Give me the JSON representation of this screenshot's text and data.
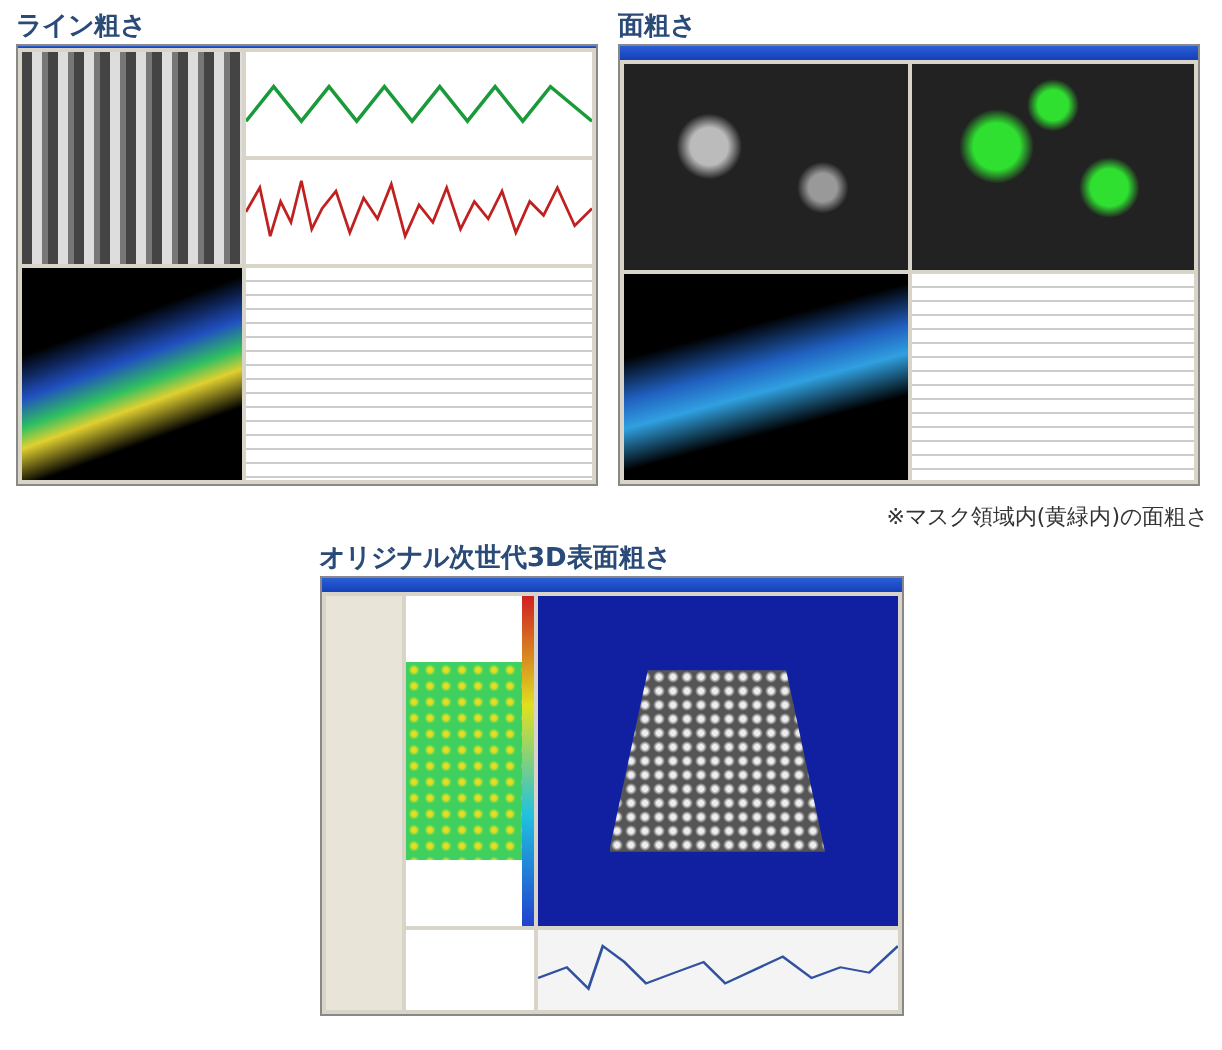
{
  "sections": [
    {
      "kind": "line",
      "title": "ライン粗さ"
    },
    {
      "kind": "area",
      "title": "面粗さ",
      "note": "※マスク領域内(黄緑内)の面粗さ"
    },
    {
      "kind": "next3d",
      "title": "オリジナル次世代3D表面粗さ"
    }
  ]
}
